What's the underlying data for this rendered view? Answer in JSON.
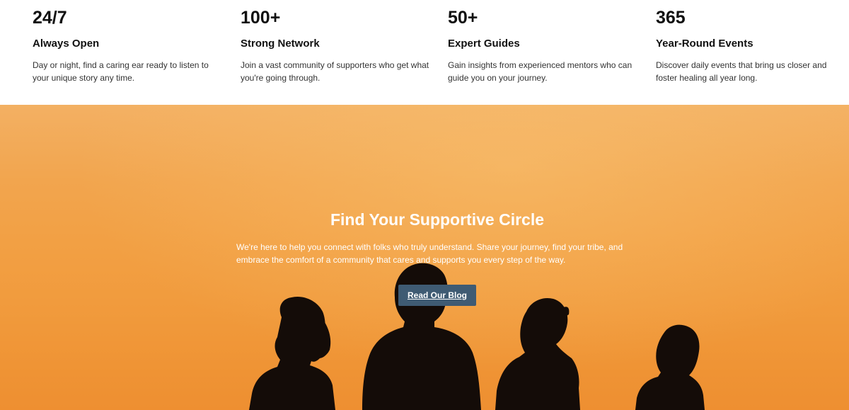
{
  "stats": [
    {
      "number": "24/7",
      "title": "Always Open",
      "description": "Day or night, find a caring ear ready to listen to your unique story any time."
    },
    {
      "number": "100+",
      "title": "Strong Network",
      "description": "Join a vast community of supporters who get what you're going through."
    },
    {
      "number": "50+",
      "title": "Expert Guides",
      "description": "Gain insights from experienced mentors who can guide you on your journey."
    },
    {
      "number": "365",
      "title": "Year-Round Events",
      "description": "Discover daily events that bring us closer and foster healing all year long."
    }
  ],
  "hero": {
    "title": "Find Your Supportive Circle",
    "text": "We're here to help you connect with folks who truly understand. Share your journey, find your tribe, and embrace the comfort of a community that cares and supports you every step of the way.",
    "button_label": "Read Our Blog"
  },
  "colors": {
    "button_bg": "#3f5b73",
    "sunset_orange": "#f2a044",
    "silhouette": "#140c08"
  }
}
